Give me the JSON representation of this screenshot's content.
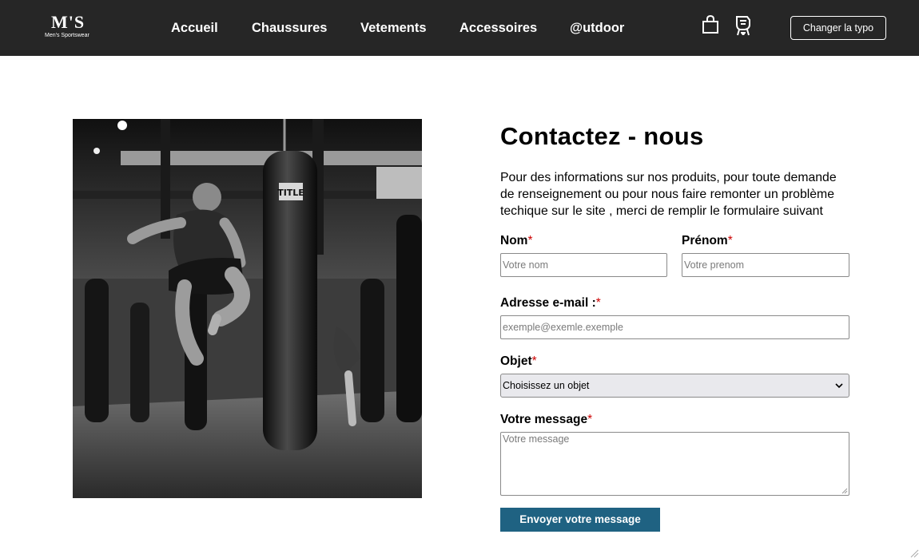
{
  "brand": {
    "mark": "M'S",
    "tagline": "Men's Sportswear"
  },
  "nav": {
    "items": [
      {
        "label": "Accueil"
      },
      {
        "label": "Chaussures"
      },
      {
        "label": "Vetements"
      },
      {
        "label": "Accessoires"
      },
      {
        "label": "@utdoor"
      }
    ],
    "cart_icon": "shopping-bag-icon",
    "account_icon": "account-icon",
    "typo_button": "Changer la typo"
  },
  "hero": {
    "image": "black-and-white photo of a man doing a flying knee kick at a punching bag in a boxing gym"
  },
  "contact": {
    "title": "Contactez - nous",
    "intro": "Pour des informations sur nos produits, pour toute demande de renseignement ou pour nous faire remonter un problème techique sur le site , merci de remplir le formulaire suivant",
    "required_mark": "*",
    "fields": {
      "nom": {
        "label": "Nom",
        "placeholder": "Votre nom",
        "value": ""
      },
      "prenom": {
        "label": "Prénom",
        "placeholder": "Votre prenom",
        "value": ""
      },
      "email": {
        "label": "Adresse e-mail :",
        "placeholder": "exemple@exemle.exemple",
        "value": ""
      },
      "objet": {
        "label": "Objet",
        "selected": "Choisissez un objet"
      },
      "message": {
        "label": "Votre message",
        "placeholder": "Votre message",
        "value": ""
      }
    },
    "submit": "Envoyer votre message"
  },
  "colors": {
    "header_bg": "#262626",
    "button_bg": "#1f6282",
    "required": "#cc0000"
  }
}
